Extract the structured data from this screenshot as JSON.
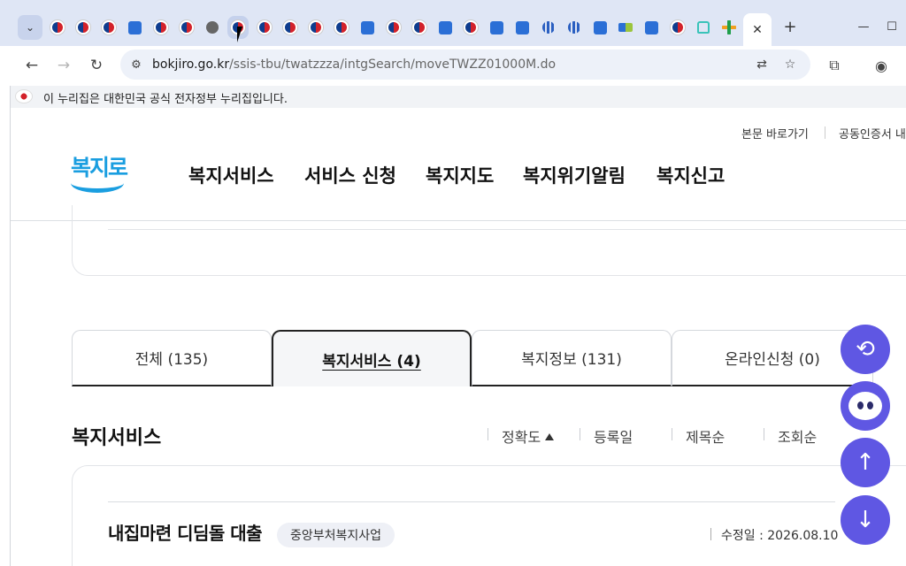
{
  "browser": {
    "tab_favicons": [
      "gov",
      "gov",
      "gov",
      "bokjiro",
      "gov",
      "gov",
      "globe",
      "gov-active",
      "gov",
      "gov",
      "gov",
      "gov",
      "bokjiro",
      "gov",
      "gov",
      "bokjiro",
      "gov",
      "bokjiro",
      "bokjiro",
      "building",
      "building",
      "bokjiro",
      "lh",
      "bokjiro",
      "gov",
      "house",
      "plus"
    ],
    "active_tab_close": "✕",
    "new_tab": "+",
    "url_host": "bokjiro.go.kr",
    "url_path": "/ssis-tbu/twatzzza/intgSearch/moveTWZZ01000M.do"
  },
  "govbar": {
    "text": "이 누리집은 대한민국 공식 전자정부 누리집입니다."
  },
  "header": {
    "util_links": [
      "본문 바로가기",
      "공동인증서 내"
    ],
    "logo_text": "복지로",
    "gnb": [
      "복지서비스",
      "서비스 신청",
      "복지지도",
      "복지위기알림",
      "복지신고"
    ]
  },
  "content_tabs": [
    {
      "label": "전체  (135)",
      "active": false
    },
    {
      "label": "복지서비스 (4)",
      "active": true
    },
    {
      "label": "복지정보 (131)",
      "active": false
    },
    {
      "label": "온라인신청 (0)",
      "active": false
    }
  ],
  "section": {
    "title": "복지서비스",
    "sort_options": [
      "정확도",
      "등록일",
      "제목순",
      "조회순"
    ]
  },
  "result": {
    "title": "내집마련 디딤돌 대출",
    "badge": "중앙부처복지사업",
    "date_label": "수정일 : 2026.08.10"
  }
}
